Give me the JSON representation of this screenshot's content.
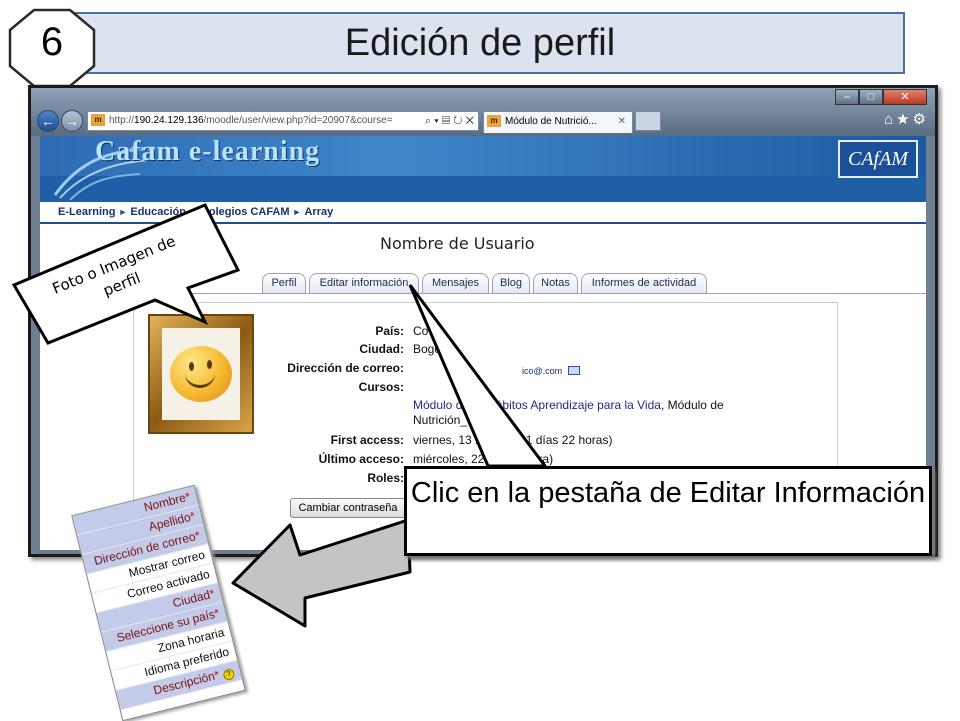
{
  "slide": {
    "step_number": "6",
    "title": "Edición de perfil"
  },
  "browser": {
    "address_prefix": "http://",
    "address_host": "190.24.129.136",
    "address_path": "/moodle/user/view.php?id=20907&course=",
    "tab_label": "Módulo de Nutrició...",
    "favicon_text": "m"
  },
  "site": {
    "logo_text": "Cafam e-learning",
    "brand_badge": "CAfAM",
    "breadcrumb": [
      "E-Learning",
      "Educación",
      "Colegios CAFAM",
      "Array"
    ]
  },
  "profile": {
    "username": "Nombre de Usuario",
    "tabs": [
      "Perfil",
      "Editar información",
      "Mensajes",
      "Blog",
      "Notas",
      "Informes de actividad"
    ],
    "fields": [
      {
        "label": "País:",
        "value": "Co"
      },
      {
        "label": "Ciudad:",
        "value": "Bogo"
      },
      {
        "label": "Dirección de correo:",
        "value": "ico@.com"
      },
      {
        "label": "Cursos:",
        "value": ""
      },
      {
        "label": "First access:",
        "value": "viernes, 13                         13:28  (221 días 22 horas)"
      },
      {
        "label": "Último acceso:",
        "value": "miércoles, 22                      2:20  (ahora)"
      },
      {
        "label": "Roles:",
        "value": ""
      }
    ],
    "courses_line1_a": "Módulo d",
    "courses_line1_b": "ábitos Aprendizaje para la Vida",
    "courses_line1_c": ", Módulo de",
    "courses_line2": "Nutrición_                     Cafam",
    "change_password_button": "Cambiar contraseña"
  },
  "callouts": {
    "main": "Clic en la pestaña de Editar Información",
    "photo": "Foto o Imagen de perfil"
  },
  "form_snippet": {
    "rows": [
      {
        "label": "Nombre",
        "required": true
      },
      {
        "label": "Apellido",
        "required": true
      },
      {
        "label": "Dirección de correo",
        "required": true
      },
      {
        "label": "Mostrar correo",
        "required": false
      },
      {
        "label": "Correo activado",
        "required": false
      },
      {
        "label": "Ciudad",
        "required": true
      },
      {
        "label": "Seleccione su país",
        "required": true
      },
      {
        "label": "Zona horaria",
        "required": false
      },
      {
        "label": "Idioma preferido",
        "required": false
      },
      {
        "label": "Descripción",
        "required": true
      }
    ],
    "required_mark": "*",
    "help_icon_text": "?"
  },
  "colors": {
    "title_bg": "#dbe3ee",
    "site_blue": "#1f5fa8",
    "link_color": "#1d2a8a",
    "required_row_bg": "#c3cbe8",
    "arrow_gray": "#c4c4c4"
  },
  "icons": [
    "back-icon",
    "forward-icon",
    "search-icon",
    "refresh-icon",
    "stop-icon",
    "home-icon",
    "star-icon",
    "gear-icon",
    "mail-icon",
    "help-icon"
  ]
}
